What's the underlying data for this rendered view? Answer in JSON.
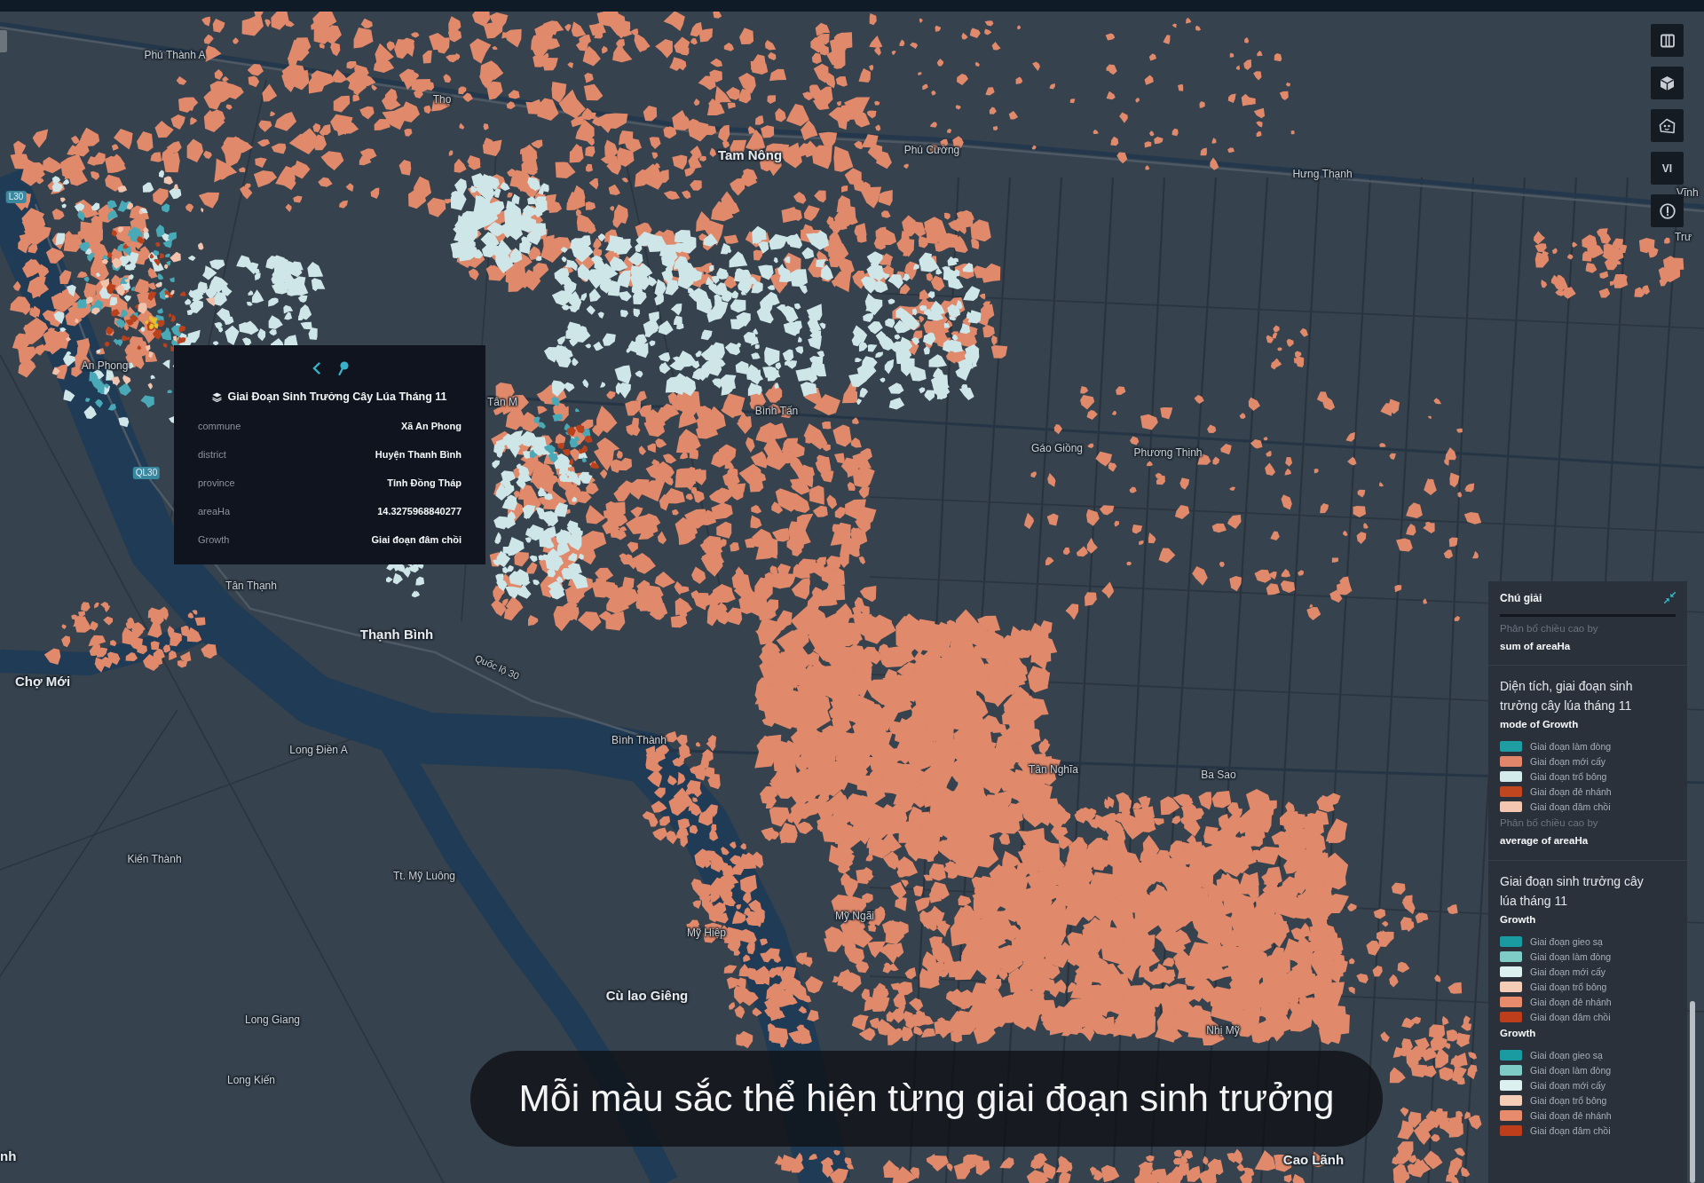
{
  "map": {
    "labels": [
      {
        "kind": "place",
        "text": "Phú Thành A"
      },
      {
        "kind": "place",
        "text": "Thọ"
      },
      {
        "kind": "town",
        "text": "Tam Nông"
      },
      {
        "kind": "place",
        "text": "Phú Cường"
      },
      {
        "kind": "place",
        "text": "Hưng Thạnh"
      },
      {
        "kind": "edge",
        "text": "Vĩnh"
      },
      {
        "kind": "edge",
        "text": "Trư"
      },
      {
        "kind": "place",
        "text": "An Phong"
      },
      {
        "kind": "edge",
        "text": "Tân M"
      },
      {
        "kind": "place",
        "text": "Bình Tấn"
      },
      {
        "kind": "place",
        "text": "Gáo Giồng"
      },
      {
        "kind": "place",
        "text": "Phương Thịnh"
      },
      {
        "kind": "place",
        "text": "Tân Thạnh"
      },
      {
        "kind": "town",
        "text": "Thạnh Bình"
      },
      {
        "kind": "town",
        "text": "Chợ Mới"
      },
      {
        "kind": "road",
        "text": "Quốc lộ 30"
      },
      {
        "kind": "place",
        "text": "Long Điền A"
      },
      {
        "kind": "place",
        "text": "Bình Thành"
      },
      {
        "kind": "place",
        "text": "Tân Nghĩa"
      },
      {
        "kind": "place",
        "text": "Ba Sao"
      },
      {
        "kind": "place",
        "text": "Kiến Thành"
      },
      {
        "kind": "place",
        "text": "Tt. Mỹ Luông"
      },
      {
        "kind": "place",
        "text": "Mỹ Ngãi"
      },
      {
        "kind": "place",
        "text": "Mỹ Hiệp"
      },
      {
        "kind": "town",
        "text": "Cù lao Giêng"
      },
      {
        "kind": "place",
        "text": "Long Giang"
      },
      {
        "kind": "place",
        "text": "Long Kiến"
      },
      {
        "kind": "place",
        "text": "Nhị Mỹ"
      },
      {
        "kind": "town",
        "text": "Cao Lãnh"
      },
      {
        "kind": "town_edge",
        "text": "nh"
      },
      {
        "kind": "shield",
        "text": "L30"
      },
      {
        "kind": "shield",
        "text": "QL30"
      }
    ]
  },
  "tooltip": {
    "title": "Giai Đoạn Sinh Trưởng Cây Lúa Tháng 11",
    "rows": [
      {
        "label": "commune",
        "value": "Xã An Phong"
      },
      {
        "label": "district",
        "value": "Huyện Thanh Bình"
      },
      {
        "label": "province",
        "value": "Tỉnh Đồng Tháp"
      },
      {
        "label": "areaHa",
        "value": "14.3275968840277"
      },
      {
        "label": "Growth",
        "value": "Giai đoạn đâm chồi"
      }
    ]
  },
  "map_controls": {
    "language": "VI"
  },
  "legend": {
    "title": "Chú giải",
    "sections": [
      {
        "entries": [
          {
            "kind": "caption",
            "text": "Phân bố chiều cao by"
          },
          {
            "kind": "field",
            "text": "sum of areaHa"
          }
        ]
      },
      {
        "entries": [
          {
            "kind": "title",
            "text": "Diện tích, giai đoạn sinh trưởng cây lúa tháng 11"
          },
          {
            "kind": "field",
            "text": "mode of Growth"
          },
          {
            "kind": "swatch",
            "text": "Giai đoạn làm đòng",
            "color": "#1f9da3"
          },
          {
            "kind": "swatch",
            "text": "Giai đoạn mới cấy",
            "color": "#e1866a"
          },
          {
            "kind": "swatch",
            "text": "Giai đoạn trổ bông",
            "color": "#d3ebea"
          },
          {
            "kind": "swatch",
            "text": "Giai đoạn đẻ nhánh",
            "color": "#c0461f"
          },
          {
            "kind": "swatch",
            "text": "Giai đoạn đâm chồi",
            "color": "#f3c6b2"
          },
          {
            "kind": "caption",
            "text": "Phân bố chiều cao by"
          },
          {
            "kind": "field",
            "text": "average of areaHa"
          }
        ]
      },
      {
        "entries": [
          {
            "kind": "title",
            "text": "Giai đoạn sinh trưởng cây lúa tháng 11"
          },
          {
            "kind": "field",
            "text": "Growth"
          },
          {
            "kind": "swatch",
            "text": "Giai đoạn gieo sạ",
            "color": "#1a9ba2"
          },
          {
            "kind": "swatch",
            "text": "Giai đoạn làm đòng",
            "color": "#7fcbc5"
          },
          {
            "kind": "swatch",
            "text": "Giai đoạn mới cấy",
            "color": "#ddf0f0"
          },
          {
            "kind": "swatch",
            "text": "Giai đoạn trổ bông",
            "color": "#f4ccb8"
          },
          {
            "kind": "swatch",
            "text": "Giai đoạn đẻ nhánh",
            "color": "#e68c6c"
          },
          {
            "kind": "swatch",
            "text": "Giai đoạn đâm chồi",
            "color": "#be3e1c"
          },
          {
            "kind": "field",
            "text": "Growth"
          },
          {
            "kind": "swatch",
            "text": "Giai đoạn gieo sạ",
            "color": "#1a9ba2"
          },
          {
            "kind": "swatch",
            "text": "Giai đoạn làm đòng",
            "color": "#7fcbc5"
          },
          {
            "kind": "swatch",
            "text": "Giai đoạn mới cấy",
            "color": "#ddf0f0"
          },
          {
            "kind": "swatch",
            "text": "Giai đoạn trổ bông",
            "color": "#f4ccb8"
          },
          {
            "kind": "swatch",
            "text": "Giai đoạn đẻ nhánh",
            "color": "#e68c6c"
          },
          {
            "kind": "swatch",
            "text": "Giai đoạn đâm chồi",
            "color": "#be3e1c"
          }
        ]
      }
    ]
  },
  "subtitle": "Mỗi màu sắc thể hiện từng giai đoạn sinh trưởng"
}
